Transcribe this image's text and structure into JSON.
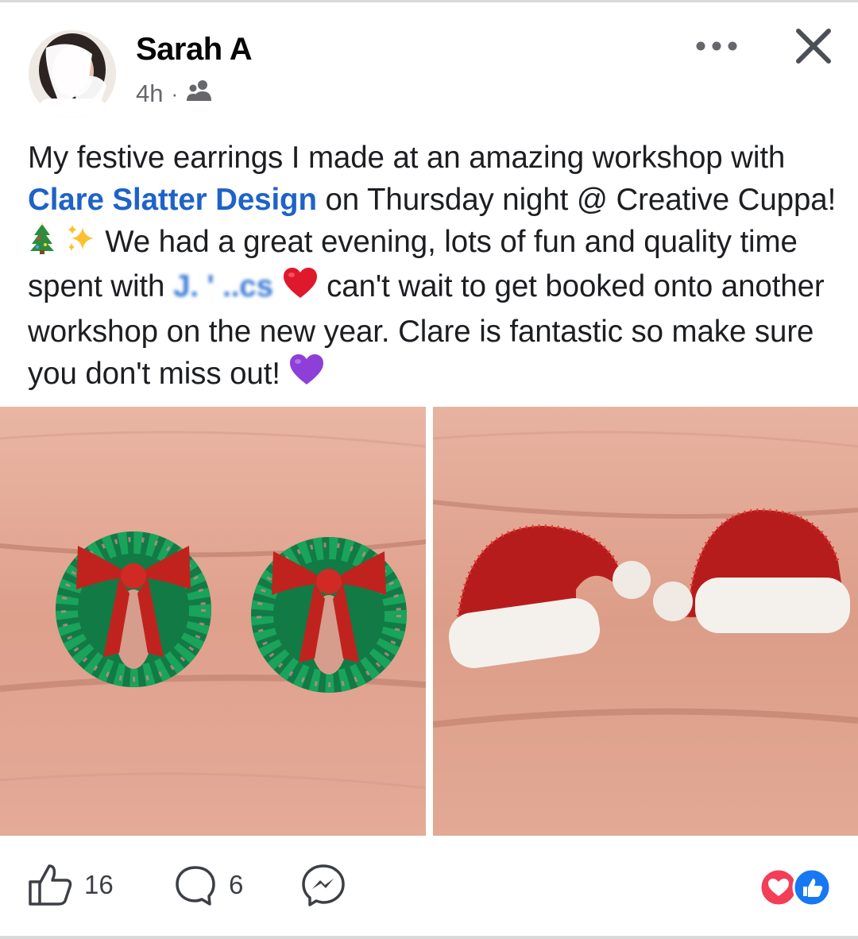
{
  "post": {
    "author": "Sarah A",
    "timestamp": "4h",
    "separator": "·",
    "audience_icon": "friends-icon",
    "text": {
      "part1": "My festive earrings I made at an amazing workshop with ",
      "mention": "Clare Slatter Design",
      "part2": " on Thursday night @ Creative Cuppa! ",
      "part3": " We had a great evening, lots of fun and quality time spent with ",
      "blurred_tag": "J.   '   ..cs",
      "part4": " can't wait to get booked onto another workshop on the new year. Clare is fantastic so make sure you don't miss out! "
    },
    "emojis": [
      "christmas-tree-icon",
      "sparkles-icon",
      "red-heart-icon",
      "purple-heart-icon"
    ],
    "photos": [
      {
        "name": "wreath-earrings-photo"
      },
      {
        "name": "santa-hat-earrings-photo"
      }
    ]
  },
  "footer": {
    "likes": "16",
    "comments": "6",
    "reactions": [
      "love-reaction-icon",
      "like-reaction-icon"
    ]
  },
  "colors": {
    "link": "#1d63c8",
    "text": "#1c1e21",
    "meta": "#65676b",
    "love": "#f33e58",
    "like": "#1877f2"
  }
}
